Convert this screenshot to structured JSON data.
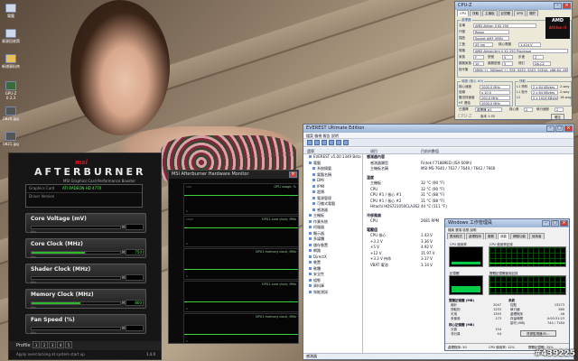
{
  "desktop": {
    "icons": [
      {
        "label": "電腦"
      },
      {
        "label": "資源回收筒"
      },
      {
        "label": "新增資料夾"
      },
      {
        "label": "GPU-Z 0.3.3"
      },
      {
        "label": "0820.jpg"
      },
      {
        "label": "0821.jpg"
      }
    ],
    "watermark": "#439225"
  },
  "afterburner": {
    "brand": "msi",
    "name": "AFTERBURNER",
    "subtitle": "MSI Graphics Card Performance Booster",
    "graphics_card_label": "Graphics Card",
    "graphics_card_value": "ATI RADEON HD 4770",
    "driver_label": "Driver Version",
    "driver_value": "",
    "sliders": [
      {
        "label": "Core Voltage (mV)",
        "min": "Min",
        "max": "Max",
        "value": "",
        "level": 0
      },
      {
        "label": "Core Clock (MHz)",
        "min": "Min",
        "max": "Max",
        "value": "750",
        "level": 0.6
      },
      {
        "label": "Shader Clock (MHz)",
        "min": "Min",
        "max": "Max",
        "value": "",
        "level": 0
      },
      {
        "label": "Memory Clock (MHz)",
        "min": "Min",
        "max": "Max",
        "value": "800",
        "level": 0.55
      },
      {
        "label": "Fan Speed (%)",
        "min": "Min",
        "max": "Max",
        "value": "",
        "level": 0
      }
    ],
    "profile_label": "Profile",
    "profiles": [
      "1",
      "2",
      "3",
      "4",
      "5"
    ],
    "startup_text": "Apply overclocking at system start up",
    "version": "1.4.0"
  },
  "hwmon": {
    "title": "MSI Afterburner Hardware Monitor",
    "graphs": [
      {
        "label": "GPU usage, %",
        "top": "100",
        "bottom": "0"
      },
      {
        "label": "GPU1 core clock, MHz",
        "top": "1500",
        "bottom": "0"
      },
      {
        "label": "GPU1 memory clock, MHz",
        "top": "",
        "bottom": "0"
      },
      {
        "label": "GPU1 core clock, MHz",
        "top": "",
        "bottom": "0"
      },
      {
        "label": "GPU1 memory clock, MHz",
        "top": "",
        "bottom": "0"
      }
    ]
  },
  "everest": {
    "title": "EVEREST Ultimate Edition",
    "menu": "檔案   檢視   報告   說明",
    "header_menu": "選單",
    "header_item": "項目",
    "header_value": "目前的數值",
    "tree": [
      "EVEREST v5.00.1349 Beta",
      "電腦",
      "系統摘要",
      "電腦名稱",
      "DMI",
      "IPMI",
      "超頻",
      "電源管理",
      "可攜式電腦",
      "感測器",
      "主機板",
      "作業系統",
      "伺服器",
      "顯示器",
      "多媒體",
      "儲存裝置",
      "網路",
      "DirectX",
      "裝置",
      "軟體",
      "安全性",
      "組態",
      "資料庫",
      "效能測試"
    ],
    "sections": [
      {
        "title": "感測器內容",
        "rows": [
          {
            "k": "感測器類型",
            "v": "Fintek F71889ED (ISA 600h)"
          },
          {
            "k": "主機板名稱",
            "v": "MSI MS-7640 / 7637 / 7640 / 7642 / 7660"
          }
        ]
      },
      {
        "title": "溫度",
        "rows": [
          {
            "k": "主機板",
            "v": "32 °C  (90 °F)"
          },
          {
            "k": "CPU",
            "v": "32 °C  (90 °F)"
          },
          {
            "k": "CPU #1 / 核心 #1",
            "v": "31 °C  (88 °F)"
          },
          {
            "k": "CPU #1 / 核心 #2",
            "v": "31 °C  (88 °F)"
          },
          {
            "k": "Hitachi HDS721050CLA362",
            "v": "44 °C  (111 °F)"
          }
        ]
      },
      {
        "title": "冷卻風扇",
        "rows": [
          {
            "k": "CPU",
            "v": "2681 RPM"
          }
        ]
      },
      {
        "title": "電壓值",
        "rows": [
          {
            "k": "CPU 核心",
            "v": "1.43 V"
          },
          {
            "k": "+3.3 V",
            "v": "3.36 V"
          },
          {
            "k": "+5 V",
            "v": "4.92 V"
          },
          {
            "k": "+12 V",
            "v": "11.97 V"
          },
          {
            "k": "+3.3 V 待命",
            "v": "3.17 V"
          },
          {
            "k": "VBAT 電池",
            "v": "3.14 V"
          }
        ]
      }
    ],
    "status": "感測器"
  },
  "cpuz": {
    "title": "CPU-Z",
    "tabs": [
      "CPU",
      "快取",
      "主機板",
      "記憶體",
      "SPD",
      "關於"
    ],
    "proc_title": "處理器",
    "fields": [
      {
        "k": "名稱",
        "v": "AMD Athlon II X2 250"
      },
      {
        "k": "代號",
        "v": "Regor"
      },
      {
        "k": "插座",
        "v": "Socket AM3 (938)"
      },
      {
        "k": "工藝",
        "v": "45 nm"
      },
      {
        "k": "核心電壓",
        "v": "1.424 V"
      },
      {
        "k": "規格",
        "v": "AMD Athlon(tm) II X2 250 Processor"
      },
      {
        "k": "家族",
        "v": "F"
      },
      {
        "k": "型號",
        "v": "5"
      },
      {
        "k": "步進",
        "v": "2"
      },
      {
        "k": "擴展家族",
        "v": "10"
      },
      {
        "k": "擴展型號",
        "v": "5"
      },
      {
        "k": "修訂",
        "v": "DA-C2"
      },
      {
        "k": "指令集",
        "v": "MMX(+), 3DNow!(+), SSE, SSE2, SSE3, SSE4A, x86-64, AMD-V"
      }
    ],
    "clock_title": "時脈 (核心 #0)",
    "cache_title": "快取",
    "clocks": [
      {
        "k": "核心速度",
        "v": "2000.0 MHz"
      },
      {
        "k": "倍頻",
        "v": "x 10.0"
      },
      {
        "k": "匯流排速度",
        "v": "200.0 MHz"
      },
      {
        "k": "HT 連結",
        "v": "2000.0 MHz"
      }
    ],
    "caches": [
      {
        "k": "L1 資料",
        "v": "2 x 64 KBytes",
        "w": "2-way"
      },
      {
        "k": "L1 指令",
        "v": "2 x 64 KBytes",
        "w": "2-way"
      },
      {
        "k": "L2",
        "v": "2 x 1024 KBytes",
        "w": "16-way"
      }
    ],
    "selected_label": "已選擇",
    "selected_value": "處理器 #1",
    "cores_label": "核心數",
    "cores_value": "2",
    "threads_label": "執行緒數",
    "threads_value": "2",
    "logo_top": "AMD",
    "logo_bottom": "Athlon II",
    "footer_brand": "CPU-Z",
    "footer_version": "版本 1.55",
    "ok": "確定"
  },
  "taskmgr": {
    "title": "Windows 工作管理員",
    "menu": "檔案  選項  檢視  說明",
    "tabs": [
      "應用程式",
      "處理程序",
      "服務",
      "效能",
      "網路功能",
      "使用者"
    ],
    "cpu_usage_label": "CPU 使用率",
    "cpu_hist_label": "CPU 使用率記錄",
    "mem_label": "記憶體",
    "mem_hist_label": "實體記憶體使用記錄",
    "cpu_level": 0.12,
    "mem_level": 0.35,
    "phys_title": "實體記憶體 (MB)",
    "sys_title": "系統",
    "phys": [
      {
        "k": "總計",
        "v": "2047"
      },
      {
        "k": "快取的",
        "v": "1253"
      },
      {
        "k": "可用",
        "v": "1393"
      },
      {
        "k": "未使用",
        "v": "173"
      }
    ],
    "sys": [
      {
        "k": "控點",
        "v": "13273"
      },
      {
        "k": "執行緒",
        "v": "560"
      },
      {
        "k": "處理程序",
        "v": "46"
      },
      {
        "k": "存留時間",
        "v": "0:00:31:23"
      },
      {
        "k": "認可 (MB)",
        "v": "744 / 7184"
      }
    ],
    "kernel_title": "核心記憶體 (MB)",
    "kernel": [
      {
        "k": "分頁",
        "v": "154"
      },
      {
        "k": "非分頁",
        "v": "44"
      }
    ],
    "resmon": "資源監視器(R)...",
    "status_proc": "處理程序: 50",
    "status_cpu": "CPU 使用率: 12%",
    "status_mem": "實體記憶體: 35%"
  }
}
